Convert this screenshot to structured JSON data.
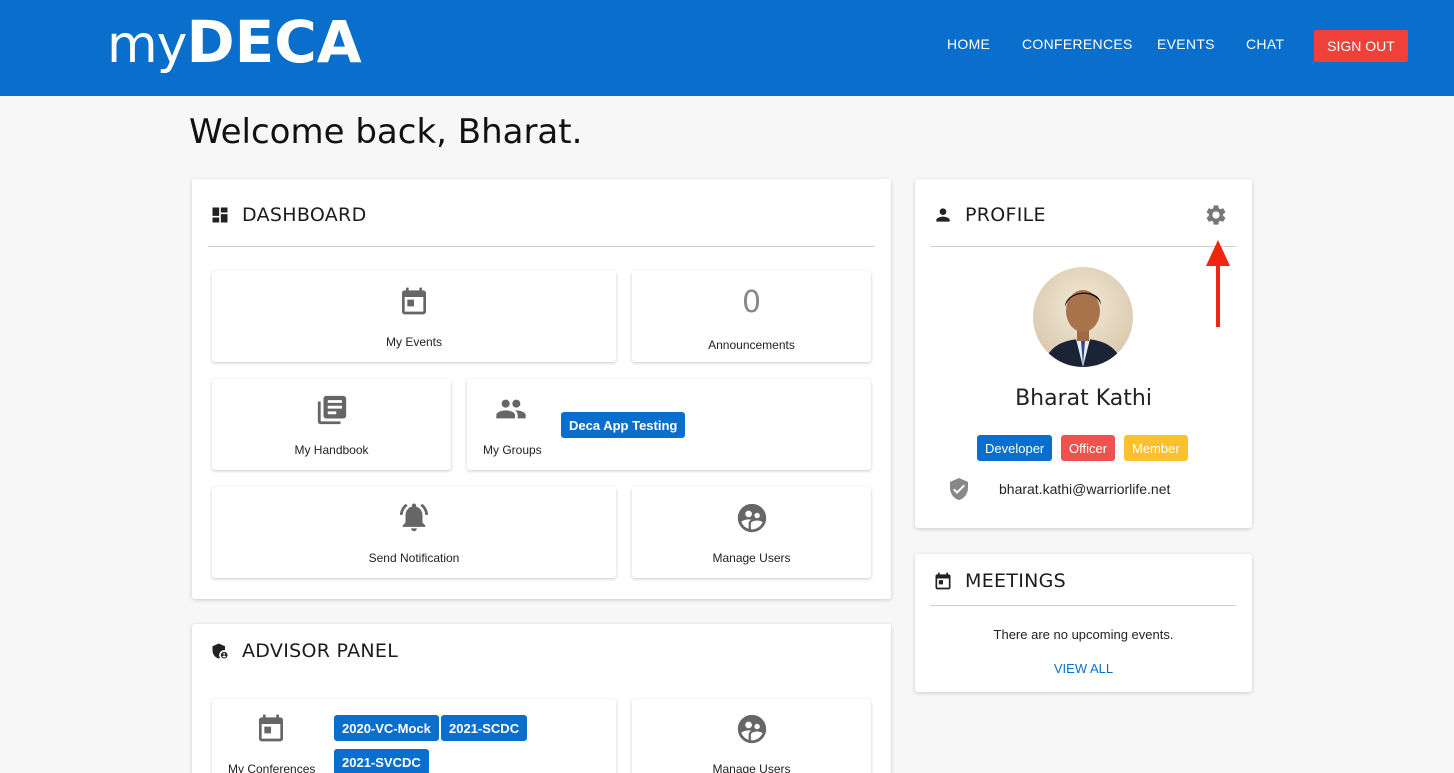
{
  "header": {
    "logo_my": "my",
    "logo_deca": "DECA",
    "nav": [
      "HOME",
      "CONFERENCES",
      "EVENTS",
      "CHAT"
    ],
    "signout_label": "SIGN OUT",
    "bg_color": "#0a6fcc",
    "signout_color": "#f0403a"
  },
  "welcome": "Welcome back, Bharat.",
  "dashboard": {
    "title": "DASHBOARD",
    "tiles": {
      "my_events": "My Events",
      "announcements_count": "0",
      "announcements": "Announcements",
      "handbook": "My Handbook",
      "groups": "My Groups",
      "group_chip": "Deca App Testing",
      "send_notification": "Send Notification",
      "manage_users": "Manage Users"
    }
  },
  "advisor": {
    "title": "ADVISOR PANEL",
    "conferences_label": "My Conferences",
    "conference_chips": [
      "2020-VC-Mock",
      "2021-SCDC",
      "2021-SVCDC"
    ],
    "manage_users": "Manage Users"
  },
  "profile": {
    "title": "PROFILE",
    "name": "Bharat Kathi",
    "roles": [
      {
        "label": "Developer",
        "color": "#0a6fcc"
      },
      {
        "label": "Officer",
        "color": "#ef5350"
      },
      {
        "label": "Member",
        "color": "#fbc02d"
      }
    ],
    "email": "bharat.kathi@warriorlife.net"
  },
  "meetings": {
    "title": "MEETINGS",
    "empty_text": "There are no upcoming events.",
    "view_all": "VIEW ALL"
  },
  "icons": [
    "dashboard-icon",
    "calendar-icon",
    "book-icon",
    "group-icon",
    "bell-icon",
    "users-icon",
    "shield-icon",
    "person-icon",
    "gear-icon",
    "verified-icon",
    "arrow-annotation"
  ]
}
